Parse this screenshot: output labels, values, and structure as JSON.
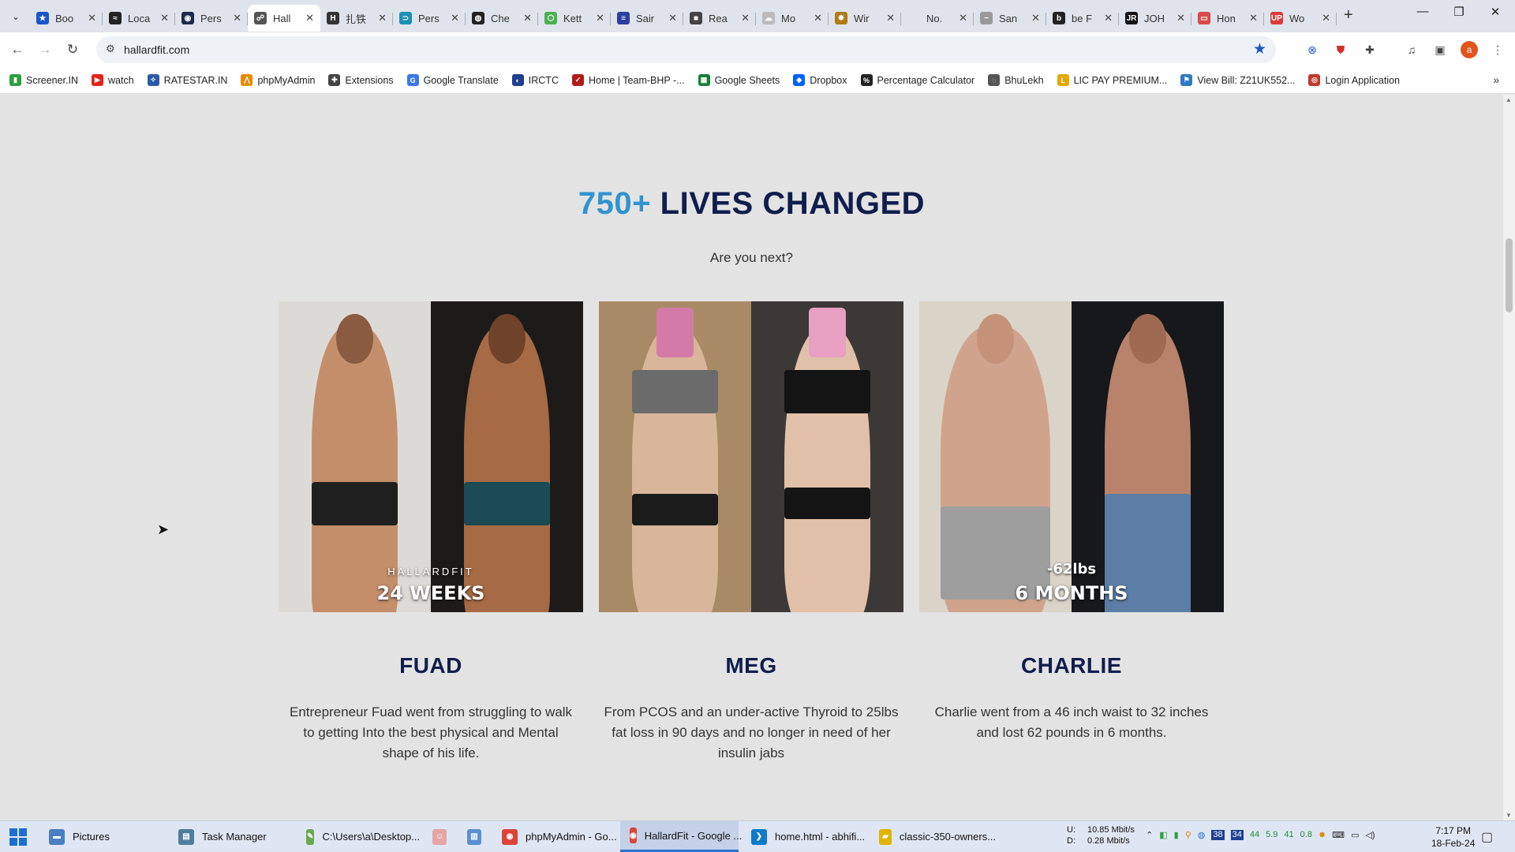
{
  "browser": {
    "tabs": [
      {
        "label": "Boo",
        "icon": "star-icon",
        "color": "#1a56c8",
        "glyph": "★"
      },
      {
        "label": "Loca",
        "icon": "signature-icon",
        "color": "#222222",
        "glyph": "≈"
      },
      {
        "label": "Pers",
        "icon": "app-icon",
        "color": "#1b2a4a",
        "glyph": "◉"
      },
      {
        "label": "Hall",
        "icon": "hallardfit-icon",
        "color": "#555555",
        "glyph": "☍",
        "active": true
      },
      {
        "label": "扎铁",
        "icon": "h-icon",
        "color": "#333333",
        "glyph": "H"
      },
      {
        "label": "Pers",
        "icon": "compass-icon",
        "color": "#1d8fb8",
        "glyph": "⊃"
      },
      {
        "label": "Che",
        "icon": "chatgpt-icon",
        "color": "#222222",
        "glyph": "◍"
      },
      {
        "label": "Kett",
        "icon": "kettlebell-icon",
        "color": "#4caf50",
        "glyph": "⬡"
      },
      {
        "label": "Sair",
        "icon": "flag-icon",
        "color": "#2b3ea0",
        "glyph": "≡"
      },
      {
        "label": "Rea",
        "icon": "cube-icon",
        "color": "#444444",
        "glyph": "■"
      },
      {
        "label": "Mo",
        "icon": "cloud-icon",
        "color": "#bbbbbb",
        "glyph": "☁"
      },
      {
        "label": "Wir",
        "icon": "sun-icon",
        "color": "#b07a1a",
        "glyph": "✸"
      },
      {
        "label": "No.",
        "icon": "blank-icon",
        "color": "#dfe3eb",
        "glyph": ""
      },
      {
        "label": "San",
        "icon": "dash-icon",
        "color": "#999999",
        "glyph": "−"
      },
      {
        "label": "be F",
        "icon": "behance-icon",
        "color": "#222222",
        "glyph": "b"
      },
      {
        "label": "JOH",
        "icon": "jr-icon",
        "color": "#111111",
        "glyph": "JR"
      },
      {
        "label": "Hon",
        "icon": "page-icon",
        "color": "#d94a4a",
        "glyph": "▭"
      },
      {
        "label": "Wo",
        "icon": "up-icon",
        "color": "#d93b3b",
        "glyph": "UP"
      }
    ],
    "url": "hallardfit.com",
    "bookmarks": [
      {
        "label": "Screener.IN",
        "icon": "chart-icon",
        "color": "#2e9e3f",
        "glyph": "▮"
      },
      {
        "label": "watch",
        "icon": "youtube-icon",
        "color": "#e62117",
        "glyph": "▶"
      },
      {
        "label": "RATESTAR.IN",
        "icon": "ratestar-icon",
        "color": "#2b5aa5",
        "glyph": "✧"
      },
      {
        "label": "phpMyAdmin",
        "icon": "phpmyadmin-icon",
        "color": "#e68a00",
        "glyph": "⋀"
      },
      {
        "label": "Extensions",
        "icon": "puzzle-icon",
        "color": "#444444",
        "glyph": "✚"
      },
      {
        "label": "Google Translate",
        "icon": "translate-icon",
        "color": "#3b78e7",
        "glyph": "G"
      },
      {
        "label": "IRCTC",
        "icon": "irctc-icon",
        "color": "#1f3f8f",
        "glyph": "◐"
      },
      {
        "label": "Home | Team-BHP -...",
        "icon": "teambhp-icon",
        "color": "#b01c1c",
        "glyph": "✓"
      },
      {
        "label": "Google Sheets",
        "icon": "sheets-icon",
        "color": "#188038",
        "glyph": "▦"
      },
      {
        "label": "Dropbox",
        "icon": "dropbox-icon",
        "color": "#0061fe",
        "glyph": "◆"
      },
      {
        "label": "Percentage Calculator",
        "icon": "percent-icon",
        "color": "#222222",
        "glyph": "%"
      },
      {
        "label": "BhuLekh",
        "icon": "globe-icon",
        "color": "#555555",
        "glyph": "◌"
      },
      {
        "label": "LIC PAY PREMIUM...",
        "icon": "lic-icon",
        "color": "#e0a800",
        "glyph": "L"
      },
      {
        "label": "View Bill: Z21UK552...",
        "icon": "bill-icon",
        "color": "#2f7bc4",
        "glyph": "⚑"
      },
      {
        "label": "Login Application",
        "icon": "login-icon",
        "color": "#c0392b",
        "glyph": "◎"
      }
    ]
  },
  "page": {
    "headline_accent": "750+",
    "headline_main": "LIVES CHANGED",
    "subheadline": "Are you next?",
    "stories": [
      {
        "name": "FUAD",
        "caption_top": "HALLARDFIT",
        "caption_bottom": "24 WEEKS",
        "description": "Entrepreneur Fuad went from struggling to walk to getting Into the best physical and Mental shape of his life."
      },
      {
        "name": "MEG",
        "caption_top": "",
        "caption_bottom": "",
        "description": "From PCOS and an under-active Thyroid to 25lbs fat loss in 90 days and no longer in need of her insulin jabs"
      },
      {
        "name": "CHARLIE",
        "caption_top": "-62lbs",
        "caption_bottom": "6 MONTHS",
        "description": "Charlie went from a 46 inch waist to 32 inches and lost 62 pounds in 6 months."
      }
    ]
  },
  "taskbar": {
    "items": [
      {
        "label": "Pictures",
        "icon": "pictures-icon",
        "color": "#4a7fc1",
        "glyph": "▬"
      },
      {
        "label": "Task Manager",
        "icon": "taskmanager-icon",
        "color": "#4f7e9c",
        "glyph": "▤"
      },
      {
        "label": "C:\\Users\\a\\Desktop...",
        "icon": "notepadpp-icon",
        "color": "#6aa84f",
        "glyph": "✎"
      },
      {
        "label": "",
        "icon": "app-face-icon",
        "color": "#e6a4a4",
        "glyph": "☺"
      },
      {
        "label": "",
        "icon": "notepad-icon",
        "color": "#5b8fd1",
        "glyph": "▥"
      },
      {
        "label": "phpMyAdmin - Go...",
        "icon": "chrome-icon",
        "color": "#db4437",
        "glyph": "◉"
      },
      {
        "label": "HallardFit - Google ...",
        "icon": "chrome-icon",
        "color": "#db4437",
        "glyph": "◉",
        "active": true
      },
      {
        "label": "home.html - abhifi...",
        "icon": "vscode-icon",
        "color": "#0e7acc",
        "glyph": "❯"
      },
      {
        "label": "classic-350-owners...",
        "icon": "file-icon",
        "color": "#e0b400",
        "glyph": "▰"
      }
    ],
    "net_up_label": "U:",
    "net_down_label": "D:",
    "net_up": "10.85 Mbit/s",
    "net_down": "0.28 Mbit/s",
    "tray_values": [
      "44",
      "5.9",
      "41",
      "0.8"
    ],
    "time": "7:17 PM",
    "date": "18-Feb-24"
  },
  "colors": {
    "accent": "#2f93d2",
    "heading": "#0f1e4d",
    "page_background": "#e3e3e3"
  }
}
